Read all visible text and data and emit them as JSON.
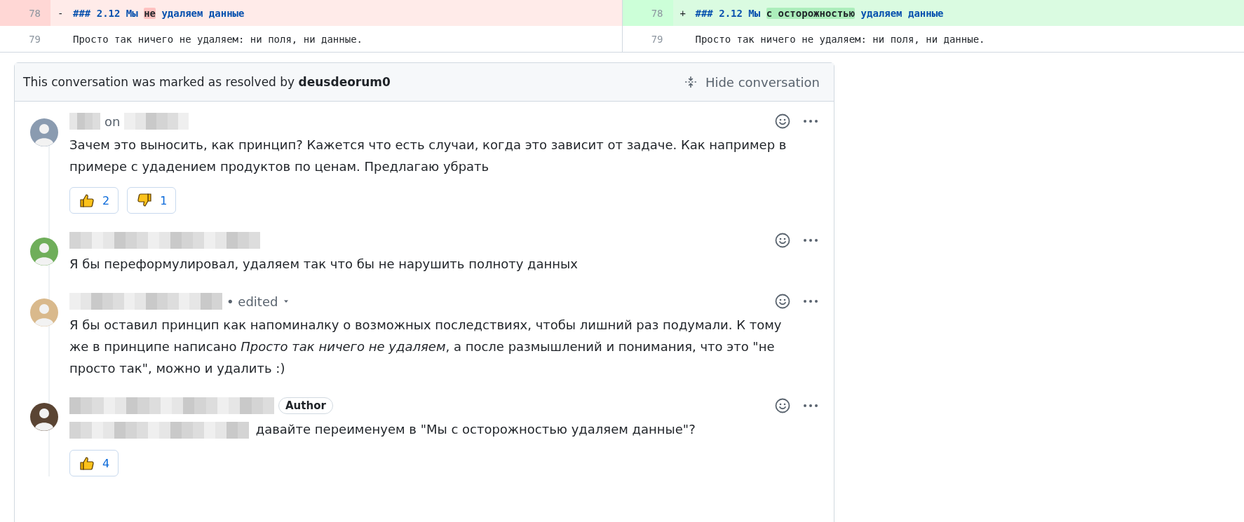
{
  "diff": {
    "rows": [
      {
        "left": {
          "number": "78",
          "sign": "-",
          "kind": "removed",
          "segments": [
            {
              "text": "### 2.12 Мы ",
              "highlight": false
            },
            {
              "text": "не",
              "highlight": true
            },
            {
              "text": " удаляем данные",
              "highlight": false
            }
          ]
        },
        "right": {
          "number": "78",
          "sign": "+",
          "kind": "added",
          "segments": [
            {
              "text": "### 2.12 Мы ",
              "highlight": false
            },
            {
              "text": "с осторожностью",
              "highlight": true
            },
            {
              "text": " удаляем данные",
              "highlight": false
            }
          ]
        }
      },
      {
        "left": {
          "number": "79",
          "kind": "context",
          "segments": [
            {
              "text": "Просто так ничего не удаляем: ни поля, ни данные.",
              "highlight": false
            }
          ]
        },
        "right": {
          "number": "79",
          "kind": "context",
          "segments": [
            {
              "text": "Просто так ничего не удаляем: ни поля, ни данные.",
              "highlight": false
            }
          ]
        }
      }
    ]
  },
  "conversation": {
    "resolved_text": "This conversation was marked as resolved by",
    "resolved_by": "deusdeorum0",
    "hide_button": "Hide conversation",
    "comments": [
      {
        "on_text": "on",
        "body": "Зачем это выносить, как принцип? Кажется что есть случаи, когда это зависит от задаче. Как например в примере с удадением продуктов по ценам. Предлагаю убрать",
        "reactions": [
          {
            "kind": "thumbs_up",
            "count": "2"
          },
          {
            "kind": "thumbs_down",
            "count": "1"
          }
        ]
      },
      {
        "body": "Я бы переформулировал, удаляем так что бы не нарушить полноту данных"
      },
      {
        "edited": "• edited",
        "body": "Я бы оставил принцип как напоминалку о возможных последствиях, чтобы лишний раз подумали. К тому же в принципе написано *Просто так ничего не удаляем*, а после размышлений и понимания, что это \"не просто так\", можно и удалить :)"
      },
      {
        "author_badge": "Author",
        "body_redacted_prefix": true,
        "body": "давайте переименуем в \"Мы с осторожностью удаляем данные\"?",
        "reactions": [
          {
            "kind": "thumbs_up",
            "count": "4"
          }
        ]
      }
    ]
  }
}
